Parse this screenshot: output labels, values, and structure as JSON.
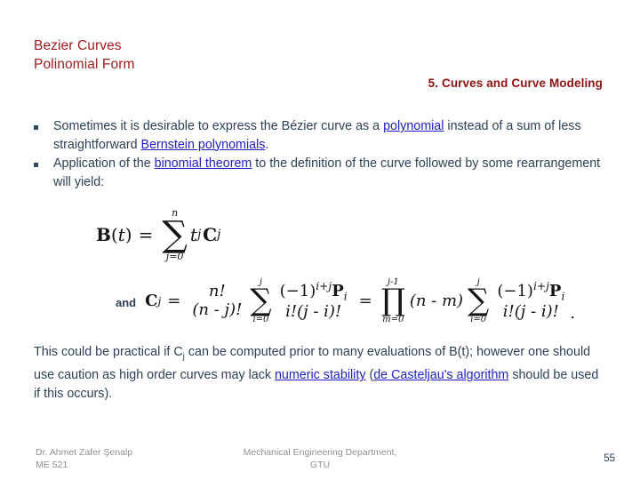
{
  "slide": {
    "title_lines": [
      "Bezier Curves",
      "Polinomial Form"
    ],
    "section_header": "5. Curves and Curve Modeling",
    "title_color": "#9e1b1b",
    "header_color": "#8c1212",
    "body_color": "#2e4057",
    "link_color": "#1f1fc4",
    "footer_color": "#8f8f8f",
    "page_number_color": "#2a3b57"
  },
  "bullets": [
    {
      "marker": "square-bullet",
      "segments": [
        {
          "text": "Sometimes it is desirable to express the Bézier curve as a ",
          "link": false
        },
        {
          "text": "polynomial",
          "link": true
        },
        {
          "text": " instead of a sum of less straightforward ",
          "link": false
        },
        {
          "text": "Bernstein polynomials",
          "link": true
        },
        {
          "text": ".",
          "link": false
        }
      ]
    },
    {
      "marker": "square-bullet",
      "segments": [
        {
          "text": "Application of the ",
          "link": false
        },
        {
          "text": "binomial theorem",
          "link": true
        },
        {
          "text": " to the definition of the curve followed by some rearrangement will yield:",
          "link": false
        }
      ]
    }
  ],
  "formulas": {
    "and_label": "and",
    "eq1": {
      "lhs": "B(t)",
      "equals": "=",
      "operator": "sum",
      "op_upper": "n",
      "op_lower": "j=0",
      "body": "t^j C_j",
      "plain": "B(t) = sum_{j=0}^{n} t^j C_j"
    },
    "eq2": {
      "lhs": "C_j",
      "equals": "=",
      "term1_num": "n!",
      "term1_den": "(n - j)!",
      "sum1_upper": "j",
      "sum1_lower": "i=0",
      "sum1_num": "(-1)^{i+j} P_i",
      "sum1_den": "i!(j - i)!",
      "equals2": "=",
      "prod_upper": "j-1",
      "prod_lower": "m=0",
      "prod_body": "(n - m)",
      "sum2_upper": "j",
      "sum2_lower": "i=0",
      "sum2_num": "(-1)^{i+j} P_i",
      "sum2_den": "i!(j - i)!",
      "trailing": ".",
      "plain": "C_j = n!/(n-j)! sum_{i=0}^{j} (-1)^{i+j} P_i / (i!(j-i)!) = prod_{m=0}^{j-1} (n-m) sum_{i=0}^{j} (-1)^{i+j} P_i / (i!(j-i)!)."
    },
    "symbols": {
      "sum_glyph": "∑",
      "prod_glyph": "∏",
      "minus": "−"
    }
  },
  "closing": {
    "segments": [
      {
        "text": "This could be practical if C",
        "link": false
      },
      {
        "text": "j",
        "link": false,
        "sub": true
      },
      {
        "text": " can be computed prior to many evaluations of B(t); however one should use caution as high order curves may lack ",
        "link": false
      },
      {
        "text": "numeric stability",
        "link": true
      },
      {
        "text": " (",
        "link": false
      },
      {
        "text": "de Casteljau's algorithm",
        "link": true
      },
      {
        "text": " should be used if this occurs).",
        "link": false
      }
    ]
  },
  "footer": {
    "left_line1": "Dr. Ahmet Zafer Şenalp",
    "left_line2": "ME 521",
    "center_line1": "Mechanical Engineering Department,",
    "center_line2": "GTU",
    "page_number": "55"
  }
}
